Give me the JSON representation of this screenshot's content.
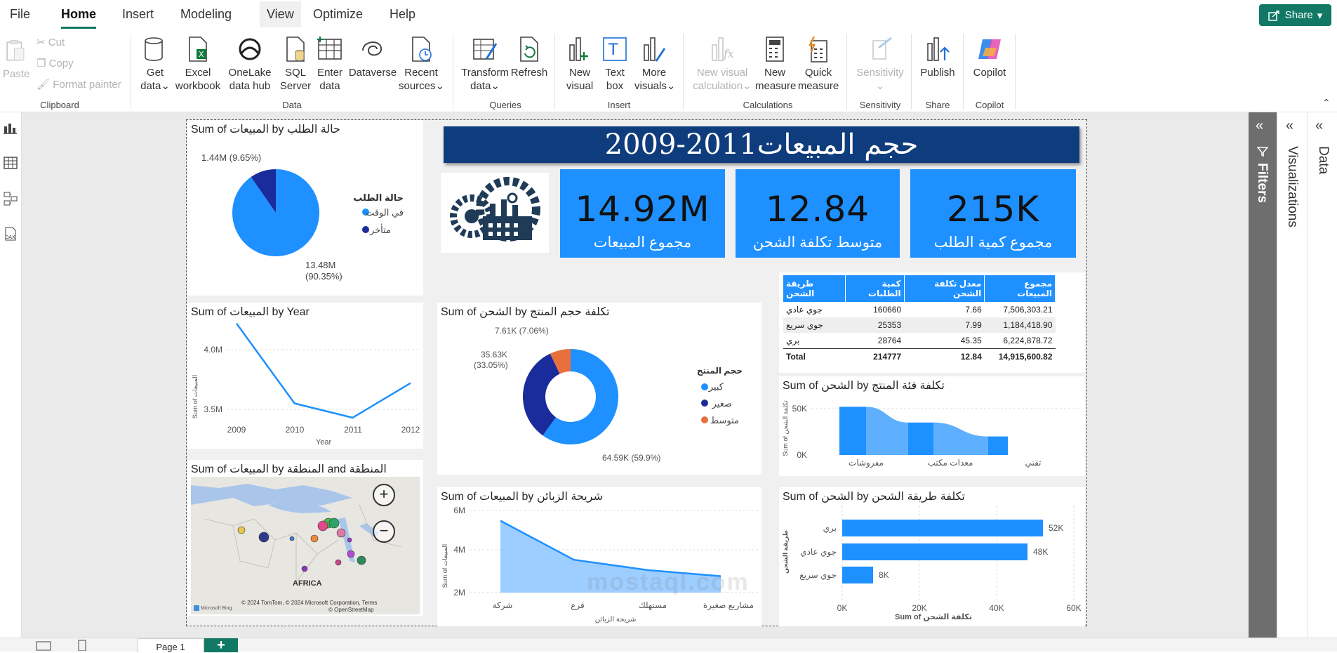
{
  "menu": {
    "items": [
      "File",
      "Home",
      "Insert",
      "Modeling",
      "View",
      "Optimize",
      "Help"
    ],
    "active": "Home",
    "share": "Share"
  },
  "ribbon": {
    "clipboard": {
      "paste": "Paste",
      "cut": "Cut",
      "copy": "Copy",
      "format_painter": "Format painter",
      "group": "Clipboard"
    },
    "data": {
      "get_data": "Get data",
      "excel": "Excel workbook",
      "onelake": "OneLake data hub",
      "sql": "SQL Server",
      "enter": "Enter data",
      "dataverse": "Dataverse",
      "recent": "Recent sources",
      "group": "Data"
    },
    "queries": {
      "transform": "Transform data",
      "refresh": "Refresh",
      "group": "Queries"
    },
    "insert": {
      "new_visual": "New visual",
      "text_box": "Text box",
      "more_visuals": "More visuals",
      "group": "Insert"
    },
    "calculations": {
      "new_visual_calc": "New visual calculation",
      "new_measure": "New measure",
      "quick_measure": "Quick measure",
      "group": "Calculations"
    },
    "sensitivity": {
      "label": "Sensitivity",
      "group": "Sensitivity"
    },
    "share": {
      "publish": "Publish",
      "group": "Share"
    },
    "copilot": {
      "label": "Copilot",
      "group": "Copilot"
    }
  },
  "report": {
    "title": "حجم المبيعات2011-2009",
    "kpis": [
      {
        "value": "215K",
        "label": "مجموع كمية الطلب"
      },
      {
        "value": "12.84",
        "label": "متوسط تكلفة الشحن"
      },
      {
        "value": "14.92M",
        "label": "مجموع المبيعات"
      }
    ],
    "pie_status": {
      "title": "Sum of المبيعات by حالة الطلب",
      "legend_title": "حالة الطلب",
      "legend": [
        "في الوقت",
        "متأخر"
      ],
      "labels": [
        "13.48M",
        "(90.35%)",
        "1.44M (9.65%)"
      ]
    },
    "line_year": {
      "title": "Sum of المبيعات by Year",
      "xlabel": "Year",
      "ylabel": "Sum of المبيعات",
      "yticks": [
        "4.0M",
        "3.5M"
      ],
      "xticks": [
        "2009",
        "2010",
        "2011",
        "2012"
      ]
    },
    "map": {
      "title": "Sum of المبيعات by المنطقة and المنطقة",
      "label_africa": "AFRICA",
      "credit": "© 2024 TomTom, © 2024 Microsoft Corporation, Terms",
      "credit2": "© OpenStreetMap",
      "bing": "Microsoft Bing"
    },
    "donut": {
      "title": "Sum of الشحن by تكلفة حجم المنتج",
      "legend_title": "حجم المنتج",
      "legend": [
        "كبير",
        "صغير",
        "متوسط"
      ],
      "labels": [
        "7.61K (7.06%)",
        "35.63K",
        "(33.05%)",
        "64.59K (59.9%)"
      ]
    },
    "table": {
      "headers": [
        "مجموع المبيعات",
        "معدل تكلفة الشحن",
        "كمية الطلبات",
        "طريقة الشحن"
      ],
      "rows": [
        [
          "7,506,303.21",
          "7.66",
          "160660",
          "جوي عادي"
        ],
        [
          "1,184,418.90",
          "7.99",
          "25353",
          "جوي سريع"
        ],
        [
          "6,224,878.72",
          "45.35",
          "28764",
          "بري"
        ]
      ],
      "total": [
        "14,915,600.82",
        "12.84",
        "214777",
        "Total"
      ]
    },
    "ribbon_chart": {
      "title": "Sum of الشحن by تكلفة فئة المنتج",
      "ylabel": "Sum of تكلفة الشحن",
      "yticks": [
        "50K",
        "0K"
      ],
      "xticks": [
        "مفروشات",
        "معدات مكتب",
        "تقني"
      ]
    },
    "area_segment": {
      "title": "Sum of المبيعات by شريحة الزبائن",
      "ylabel": "Sum of المبيعات",
      "xlabel": "شريحة الزبائن",
      "yticks": [
        "6M",
        "4M",
        "2M"
      ]
    },
    "bar_method": {
      "title": "Sum of الشحن by تكلفة طريقة الشحن",
      "ylabel": "طريقة الشحن",
      "xlabel": "Sum of تكلفة الشحن",
      "xticks": [
        "0K",
        "20K",
        "40K",
        "60K"
      ]
    }
  },
  "chart_data": [
    {
      "type": "pie",
      "title": "Sum of المبيعات by حالة الطلب",
      "categories": [
        "في الوقت",
        "متأخر"
      ],
      "values": [
        13.48,
        1.44
      ],
      "unit": "M",
      "legend": "right"
    },
    {
      "type": "line",
      "title": "Sum of المبيعات by Year",
      "x": [
        2009,
        2010,
        2011,
        2012
      ],
      "values": [
        4.22,
        3.55,
        3.43,
        3.72
      ],
      "unit": "M",
      "ylim": [
        3.2,
        4.3
      ]
    },
    {
      "type": "pie",
      "title": "Sum of الشحن by تكلفة حجم المنتج",
      "categories": [
        "كبير",
        "صغير",
        "متوسط"
      ],
      "values": [
        64.59,
        35.63,
        7.61
      ],
      "unit": "K",
      "legend": "right"
    },
    {
      "type": "area",
      "title": "Sum of الشحن by تكلفة فئة المنتج",
      "categories": [
        "مفروشات",
        "معدات مكتب",
        "تقني"
      ],
      "values": [
        52,
        35,
        20
      ],
      "unit": "K",
      "ylim": [
        0,
        60
      ]
    },
    {
      "type": "area",
      "title": "Sum of المبيعات by شريحة الزبائن",
      "categories": [
        "شركة",
        "فرع",
        "مستهلك",
        "مشاريع صغيرة"
      ],
      "values": [
        5.5,
        3.6,
        3.1,
        2.8
      ],
      "unit": "M",
      "ylim": [
        2,
        6
      ]
    },
    {
      "type": "bar",
      "title": "Sum of الشحن by تكلفة طريقة الشحن",
      "categories": [
        "بري",
        "جوي عادي",
        "جوي سريع"
      ],
      "values": [
        52,
        48,
        8
      ],
      "unit": "K",
      "xlim": [
        0,
        60
      ]
    }
  ],
  "panes": {
    "filters": "Filters",
    "visualizations": "Visualizations",
    "data": "Data"
  },
  "page_tab": "Page 1",
  "watermark": "mostaql.com",
  "colors": {
    "accent": "#117865",
    "kpi": "#1e90ff",
    "title": "#0f3c7c",
    "dark_blue": "#1a2b9b",
    "orange": "#e8703d",
    "light_blue": "#5eb0ff"
  }
}
